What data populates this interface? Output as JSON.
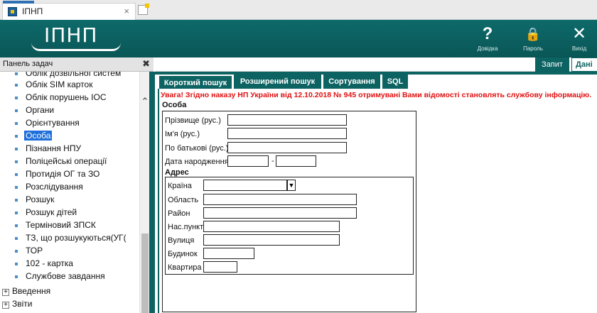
{
  "browser": {
    "tab_title": "ІПНП",
    "tab_close": "×"
  },
  "header": {
    "logo_text": "ІПНП",
    "buttons": [
      {
        "icon": "?",
        "label": "Довідка"
      },
      {
        "icon": "🔒",
        "label": "Пароль"
      },
      {
        "icon": "✕",
        "label": "Вихід"
      }
    ]
  },
  "left_panel": {
    "title": "Панель задач",
    "close": "✖",
    "items": [
      "Облік дозвільної систем",
      "Облік SIM карток",
      "Облік порушень ІОС",
      "Органи",
      "Орієнтування",
      "Особа",
      "Пізнання НПУ",
      "Поліцейські операції",
      "Протидія ОГ та ЗО",
      "Розслідування",
      "Розшук",
      "Розшук дітей",
      "Терміновий ЗПСК",
      "ТЗ, що розшукуються(УГ(",
      "ТОР",
      "102 - картка",
      "Службове завдання"
    ],
    "selected": "Особа",
    "nodes": [
      "Введення",
      "Звіти"
    ]
  },
  "toolbar": {
    "zapyt": "Запит",
    "dani": "Дані"
  },
  "tabs": [
    "Короткий пошук",
    "Розширений пошук",
    "Сортування",
    "SQL"
  ],
  "warning": "Увага! Згідно наказу НП України від 12.10.2018 № 945 отримувані Вами відомості становлять службову інформацію.",
  "person": {
    "title": "Особа",
    "surname": "Прізвище (рус.)",
    "name": "Ім'я (рус.)",
    "patronymic": "По батькові (рус.)",
    "birth_date": "Дата народження",
    "date_sep": "-"
  },
  "address": {
    "title": "Адрес",
    "country": "Країна",
    "region": "Область",
    "district": "Район",
    "settlement": "Нас.пункт",
    "street": "Вулиця",
    "house": "Будинок",
    "apartment": "Квартира"
  },
  "colors": {
    "accent": "#0d6262",
    "warning": "#e01010",
    "selection": "#1e6fd9"
  }
}
